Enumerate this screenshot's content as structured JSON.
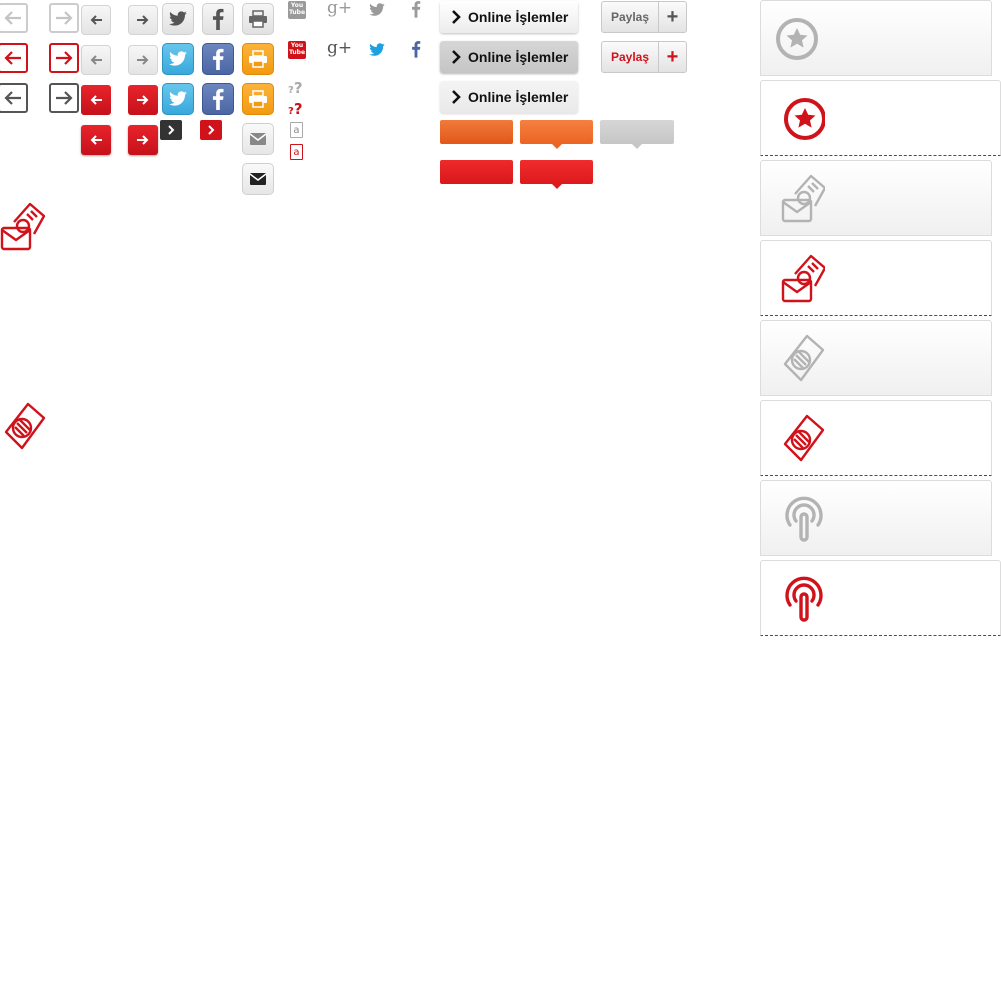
{
  "colors": {
    "red": "#d0121b",
    "grey_icon": "#b3b3b3",
    "dark": "#555555",
    "orange": "#f06a24",
    "twitter_blue": "#38a9dc",
    "facebook_blue": "#4b66a3",
    "print_orange": "#f39a12"
  },
  "arrows": {
    "outline_rows": [
      "grey",
      "red",
      "dark"
    ],
    "small_grey_rows": 2,
    "small_red_rows": 2
  },
  "buttons": {
    "online": {
      "label": "Online İşlemler",
      "states": [
        "normal",
        "pressed",
        "disabled"
      ]
    },
    "share": {
      "label": "Paylaş",
      "plus": "+",
      "states": [
        "normal",
        "active"
      ]
    }
  },
  "social_icons": [
    "youtube-icon",
    "google-plus-icon",
    "twitter-icon",
    "facebook-icon",
    "print-icon",
    "mail-icon",
    "help-icon",
    "text-size-icon"
  ],
  "social_text": {
    "google_plus": "g+",
    "youtube_top": "You",
    "youtube_bottom": "Tube",
    "help_q": "?",
    "text_size_a": "a"
  },
  "menu_cards": [
    {
      "icon": "star-icon",
      "state": "normal"
    },
    {
      "icon": "star-icon",
      "state": "active"
    },
    {
      "icon": "sim-mail-icon",
      "state": "normal"
    },
    {
      "icon": "sim-mail-icon",
      "state": "active"
    },
    {
      "icon": "sim-card-icon",
      "state": "normal"
    },
    {
      "icon": "sim-card-icon",
      "state": "active"
    },
    {
      "icon": "broadcast-icon",
      "state": "normal"
    },
    {
      "icon": "broadcast-icon",
      "state": "active"
    }
  ]
}
